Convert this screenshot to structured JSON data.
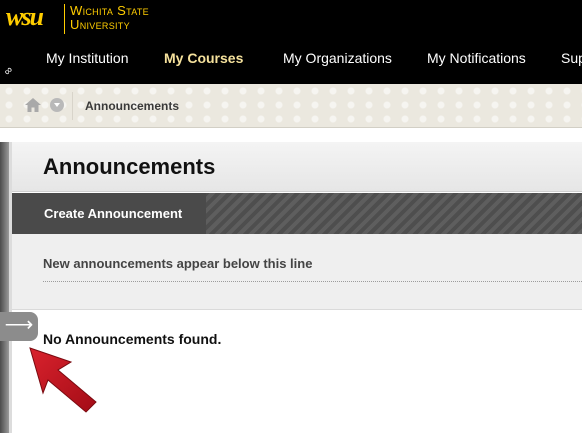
{
  "header": {
    "logo_mark": "wsu",
    "logo_line1": "Wichita State",
    "logo_line2": "University",
    "nav": [
      {
        "label": "My Institution",
        "active": false
      },
      {
        "label": "My Courses",
        "active": true
      },
      {
        "label": "My Organizations",
        "active": false
      },
      {
        "label": "My Notifications",
        "active": false
      },
      {
        "label": "Sup",
        "active": false
      }
    ],
    "link_icon": "link-icon"
  },
  "breadcrumb": {
    "home_icon": "home-icon",
    "menu_icon": "chevron-down-icon",
    "current": "Announcements"
  },
  "page": {
    "title": "Announcements",
    "create_button": "Create Announcement",
    "info_text": "New announcements appear below this line",
    "empty_message": "No Announcements found.",
    "expand_glyph": "⟶"
  },
  "colors": {
    "header_bg": "#000000",
    "brand_gold": "#ffcd00",
    "active_nav": "#f5e19c",
    "annotation_arrow": "#c2111e"
  }
}
